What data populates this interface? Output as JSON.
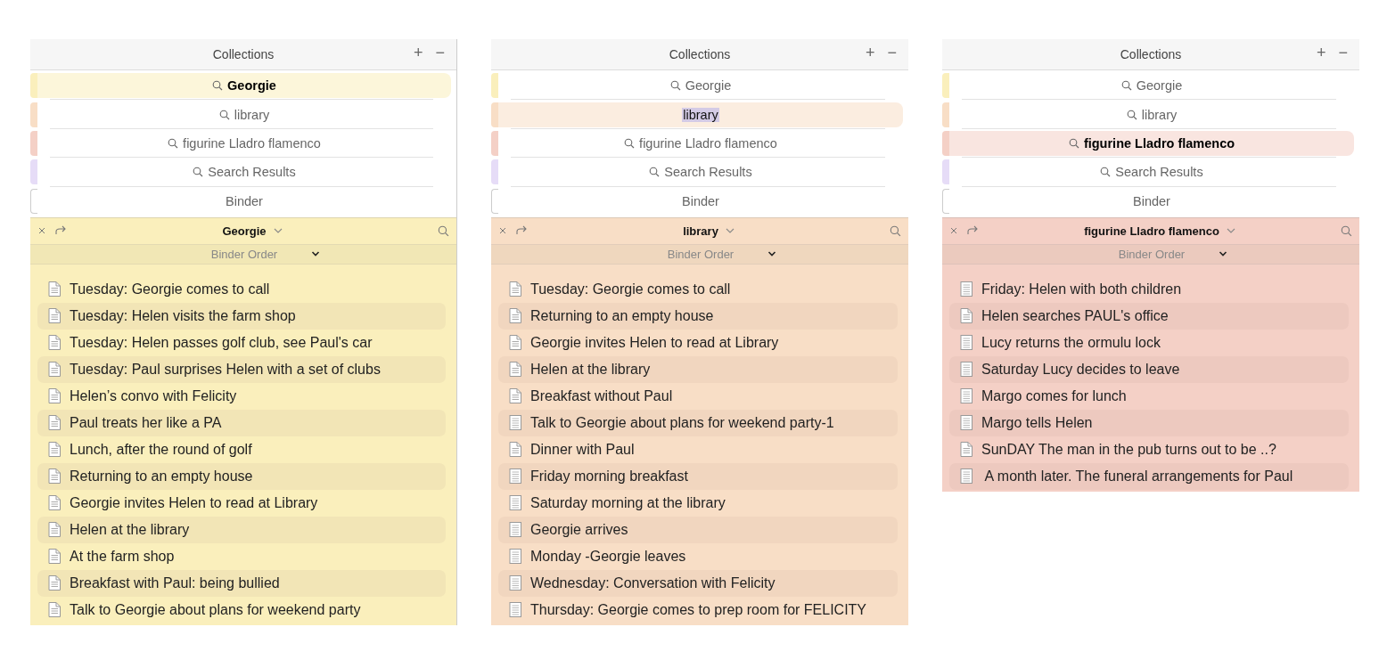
{
  "panels": [
    {
      "collections": {
        "title": "Collections",
        "add": "+",
        "remove": "−",
        "items": [
          {
            "label": "Georgie",
            "kind": "search",
            "color": "#faefbc",
            "selected": true,
            "editing": false
          },
          {
            "label": "library",
            "kind": "search",
            "color": "#f8dec6",
            "selected": false,
            "editing": false
          },
          {
            "label": "figurine Lladro flamenco",
            "kind": "search",
            "color": "#f4d0c6",
            "selected": false,
            "editing": false
          },
          {
            "label": "Search Results",
            "kind": "search",
            "color": "#e6dcf7",
            "selected": false,
            "editing": false
          },
          {
            "label": "Binder",
            "kind": "binder",
            "color": "#ffffff",
            "selected": false,
            "editing": false
          }
        ]
      },
      "header": {
        "title": "Georgie"
      },
      "sort": "Binder Order",
      "documents": [
        {
          "title": "Tuesday: Georgie comes to call",
          "kind": "text"
        },
        {
          "title": "Tuesday: Helen visits the farm shop",
          "kind": "text"
        },
        {
          "title": "Tuesday: Helen passes golf club, see Paul's car",
          "kind": "text"
        },
        {
          "title": "Tuesday: Paul surprises Helen with a set of clubs",
          "kind": "text"
        },
        {
          "title": "Helen’s convo with Felicity",
          "kind": "text"
        },
        {
          "title": "Paul treats her like a PA",
          "kind": "text"
        },
        {
          "title": "Lunch, after the round of golf",
          "kind": "text"
        },
        {
          "title": "Returning to an empty house",
          "kind": "text"
        },
        {
          "title": "Georgie invites Helen to read at Library",
          "kind": "text"
        },
        {
          "title": "Helen at the library",
          "kind": "text"
        },
        {
          "title": "At the farm shop",
          "kind": "text"
        },
        {
          "title": "Breakfast with Paul: being bullied",
          "kind": "text"
        },
        {
          "title": "Talk to Georgie about plans for weekend party",
          "kind": "text"
        }
      ]
    },
    {
      "collections": {
        "title": "Collections",
        "add": "+",
        "remove": "−",
        "items": [
          {
            "label": "Georgie",
            "kind": "search",
            "color": "#faefbc",
            "selected": false,
            "editing": false
          },
          {
            "label": "library",
            "kind": "search",
            "color": "#f8dec6",
            "selected": true,
            "editing": true
          },
          {
            "label": "figurine Lladro flamenco",
            "kind": "search",
            "color": "#f4d0c6",
            "selected": false,
            "editing": false
          },
          {
            "label": "Search Results",
            "kind": "search",
            "color": "#e6dcf7",
            "selected": false,
            "editing": false
          },
          {
            "label": "Binder",
            "kind": "binder",
            "color": "#ffffff",
            "selected": false,
            "editing": false
          }
        ]
      },
      "header": {
        "title": "library"
      },
      "sort": "Binder Order",
      "documents": [
        {
          "title": "Tuesday: Georgie comes to call",
          "kind": "text"
        },
        {
          "title": "Returning to an empty house",
          "kind": "text"
        },
        {
          "title": "Georgie invites Helen to read at Library",
          "kind": "text"
        },
        {
          "title": "Helen at the library",
          "kind": "text"
        },
        {
          "title": "Breakfast without Paul",
          "kind": "text"
        },
        {
          "title": "Talk to Georgie about plans for weekend party-1",
          "kind": "page"
        },
        {
          "title": "Dinner with Paul",
          "kind": "text"
        },
        {
          "title": "Friday morning breakfast",
          "kind": "page"
        },
        {
          "title": "Saturday morning at the library",
          "kind": "page"
        },
        {
          "title": "Georgie arrives",
          "kind": "page"
        },
        {
          "title": "Monday -Georgie leaves",
          "kind": "page"
        },
        {
          "title": "Wednesday: Conversation with Felicity",
          "kind": "page"
        },
        {
          "title": "Thursday: Georgie comes to prep room for FELICITY",
          "kind": "page"
        }
      ]
    },
    {
      "collections": {
        "title": "Collections",
        "add": "+",
        "remove": "−",
        "items": [
          {
            "label": "Georgie",
            "kind": "search",
            "color": "#faefbc",
            "selected": false,
            "editing": false
          },
          {
            "label": "library",
            "kind": "search",
            "color": "#f8dec6",
            "selected": false,
            "editing": false
          },
          {
            "label": "figurine Lladro flamenco",
            "kind": "search",
            "color": "#f4d0c6",
            "selected": true,
            "editing": false
          },
          {
            "label": "Search Results",
            "kind": "search",
            "color": "#e6dcf7",
            "selected": false,
            "editing": false
          },
          {
            "label": "Binder",
            "kind": "binder",
            "color": "#ffffff",
            "selected": false,
            "editing": false
          }
        ]
      },
      "header": {
        "title": "figurine Lladro flamenco"
      },
      "sort": "Binder Order",
      "documents": [
        {
          "title": "Friday: Helen with both children",
          "kind": "page"
        },
        {
          "title": "Helen searches PAUL's office",
          "kind": "text"
        },
        {
          "title": "Lucy returns the ormulu lock",
          "kind": "page"
        },
        {
          "title": "Saturday Lucy decides to leave",
          "kind": "page"
        },
        {
          "title": "Margo comes for lunch",
          "kind": "page"
        },
        {
          "title": "Margo tells Helen",
          "kind": "page"
        },
        {
          "title": "SunDAY The man in the pub turns out to be ..?",
          "kind": "text"
        },
        {
          "title": " A month later. The funeral arrangements for Paul",
          "kind": "page"
        }
      ]
    }
  ]
}
